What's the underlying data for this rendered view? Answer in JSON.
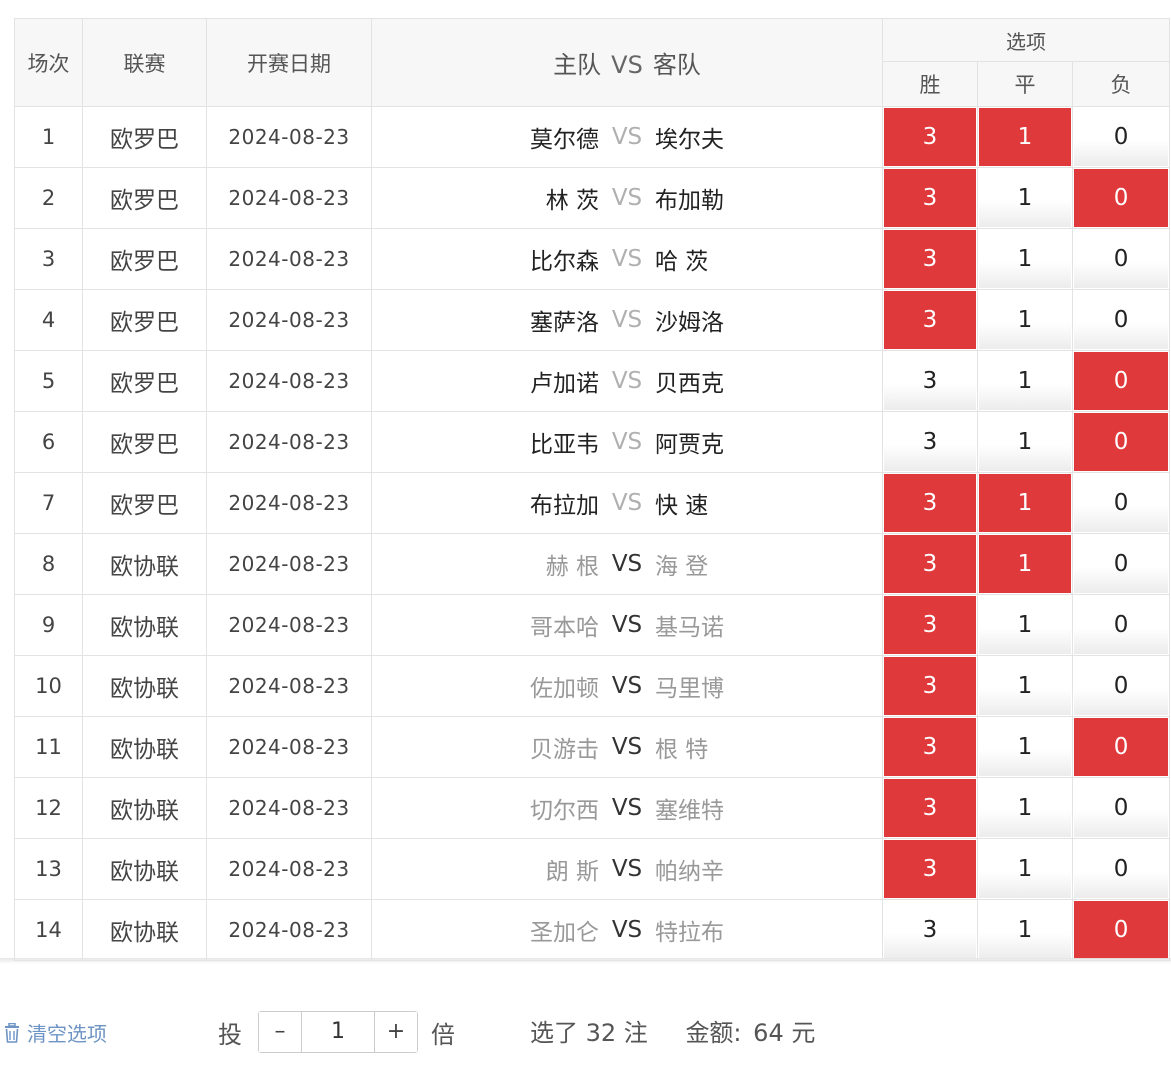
{
  "header": {
    "num": "场次",
    "league": "联赛",
    "date": "开赛日期",
    "home": "主队",
    "vs": "VS",
    "away": "客队",
    "options_group": "选项",
    "win": "胜",
    "draw": "平",
    "lose": "负"
  },
  "option_values": {
    "win": "3",
    "draw": "1",
    "lose": "0"
  },
  "colors": {
    "selected": "#e0393b",
    "dark_text": "#222222",
    "light_text": "#999999",
    "link": "#6d94c4"
  },
  "rows": [
    {
      "num": "1",
      "league": "欧罗巴",
      "date": "2024-08-23",
      "home": "莫尔德",
      "vs": "VS",
      "away": "埃尔夫",
      "dim": "vs",
      "sel": [
        true,
        true,
        false
      ]
    },
    {
      "num": "2",
      "league": "欧罗巴",
      "date": "2024-08-23",
      "home": "林 茨",
      "vs": "VS",
      "away": "布加勒",
      "dim": "vs",
      "sel": [
        true,
        false,
        true
      ]
    },
    {
      "num": "3",
      "league": "欧罗巴",
      "date": "2024-08-23",
      "home": "比尔森",
      "vs": "VS",
      "away": "哈 茨",
      "dim": "vs",
      "sel": [
        true,
        false,
        false
      ]
    },
    {
      "num": "4",
      "league": "欧罗巴",
      "date": "2024-08-23",
      "home": "塞萨洛",
      "vs": "VS",
      "away": "沙姆洛",
      "dim": "vs",
      "sel": [
        true,
        false,
        false
      ]
    },
    {
      "num": "5",
      "league": "欧罗巴",
      "date": "2024-08-23",
      "home": "卢加诺",
      "vs": "VS",
      "away": "贝西克",
      "dim": "vs",
      "sel": [
        false,
        false,
        true
      ]
    },
    {
      "num": "6",
      "league": "欧罗巴",
      "date": "2024-08-23",
      "home": "比亚韦",
      "vs": "VS",
      "away": "阿贾克",
      "dim": "vs",
      "sel": [
        false,
        false,
        true
      ]
    },
    {
      "num": "7",
      "league": "欧罗巴",
      "date": "2024-08-23",
      "home": "布拉加",
      "vs": "VS",
      "away": "快 速",
      "dim": "vs",
      "sel": [
        true,
        true,
        false
      ]
    },
    {
      "num": "8",
      "league": "欧协联",
      "date": "2024-08-23",
      "home": "赫 根",
      "vs": "VS",
      "away": "海 登",
      "dim": "teams",
      "sel": [
        true,
        true,
        false
      ]
    },
    {
      "num": "9",
      "league": "欧协联",
      "date": "2024-08-23",
      "home": "哥本哈",
      "vs": "VS",
      "away": "基马诺",
      "dim": "teams",
      "sel": [
        true,
        false,
        false
      ]
    },
    {
      "num": "10",
      "league": "欧协联",
      "date": "2024-08-23",
      "home": "佐加顿",
      "vs": "VS",
      "away": "马里博",
      "dim": "teams",
      "sel": [
        true,
        false,
        false
      ]
    },
    {
      "num": "11",
      "league": "欧协联",
      "date": "2024-08-23",
      "home": "贝游击",
      "vs": "VS",
      "away": "根 特",
      "dim": "teams",
      "sel": [
        true,
        false,
        true
      ]
    },
    {
      "num": "12",
      "league": "欧协联",
      "date": "2024-08-23",
      "home": "切尔西",
      "vs": "VS",
      "away": "塞维特",
      "dim": "teams",
      "sel": [
        true,
        false,
        false
      ]
    },
    {
      "num": "13",
      "league": "欧协联",
      "date": "2024-08-23",
      "home": "朗 斯",
      "vs": "VS",
      "away": "帕纳辛",
      "dim": "teams",
      "sel": [
        true,
        false,
        false
      ]
    },
    {
      "num": "14",
      "league": "欧协联",
      "date": "2024-08-23",
      "home": "圣加仑",
      "vs": "VS",
      "away": "特拉布",
      "dim": "teams",
      "sel": [
        false,
        false,
        true
      ]
    }
  ],
  "footer": {
    "clear_label": "清空选项",
    "clear_icon": "trash-icon",
    "bet_label": "投",
    "minus": "–",
    "multiplier": "1",
    "plus": "+",
    "times_label": "倍",
    "selected_text": "选了 32 注",
    "amount_label": "金额:",
    "amount_value": "64 元"
  }
}
